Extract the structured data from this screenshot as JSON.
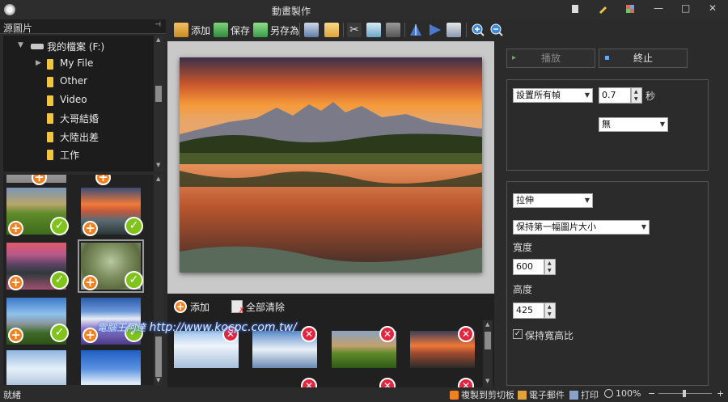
{
  "window": {
    "title": "動畫製作",
    "minimize": "—",
    "maximize": "□",
    "close": "✕"
  },
  "source_panel": {
    "title": "源圖片",
    "pin": "⊣",
    "drive": "我的檔案 (F:)",
    "folders": [
      "My File",
      "Other",
      "Video",
      "大哥結婚",
      "大陸出差",
      "工作"
    ]
  },
  "toolbar": {
    "add": "添加",
    "save": "保存",
    "save_as": "另存為"
  },
  "frames_bar": {
    "add": "添加",
    "clear_all": "全部清除"
  },
  "playback": {
    "play": "▸",
    "play_label": "播放",
    "stop": "▪",
    "stop_label": "終止"
  },
  "timing": {
    "mode": "設置所有幀",
    "value": "0.7",
    "unit": "秒",
    "effect": "無"
  },
  "size": {
    "resize_mode": "拉伸",
    "size_source": "保持第一幅圖片大小",
    "width_label": "寬度",
    "width": "600",
    "height_label": "高度",
    "height": "425",
    "keep_ratio": "保持寬高比",
    "keep_ratio_checked": true
  },
  "statusbar": {
    "status": "就緒",
    "copy": "複製到剪切板",
    "email": "電子郵件",
    "print": "打印",
    "zoom": "100%",
    "zoom_minus": "−",
    "zoom_plus": "+"
  },
  "watermark": "http://www.kocpc.com.tw/",
  "watermark_logo": "電腦王阿達"
}
